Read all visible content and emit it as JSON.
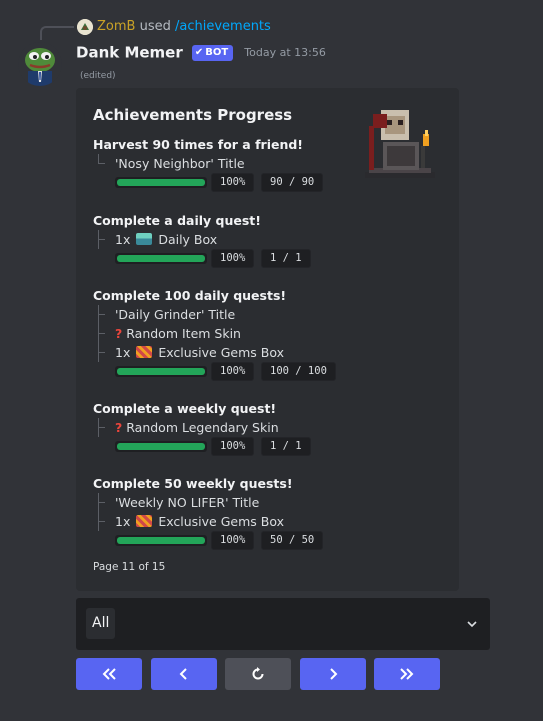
{
  "reply": {
    "username": "ZomB",
    "used_text": "used",
    "command": "/achievements"
  },
  "author": {
    "name": "Dank Memer",
    "bot_tag": "BOT",
    "timestamp": "Today at 13:56",
    "edited": "(edited)"
  },
  "embed": {
    "title": "Achievements Progress",
    "footer": "Page 11 of 15",
    "achievements": [
      {
        "name": "Harvest 90 times for a friend!",
        "rewards": [
          "'Nosy Neighbor' Title"
        ],
        "percent": "100%",
        "count": "90 / 90",
        "progress": 1.0
      },
      {
        "name": "Complete a daily quest!",
        "rewards": [
          {
            "prefix": "1x",
            "icon": "daily-box-icon",
            "label": "Daily Box"
          }
        ],
        "percent": "100%",
        "count": "1 / 1",
        "progress": 1.0
      },
      {
        "name": "Complete 100 daily quests!",
        "rewards": [
          "'Daily Grinder' Title",
          {
            "icon": "question-mark-icon",
            "label": "Random Item Skin"
          },
          {
            "prefix": "1x",
            "icon": "gems-box-icon",
            "label": "Exclusive Gems Box"
          }
        ],
        "percent": "100%",
        "count": "100 / 100",
        "progress": 1.0
      },
      {
        "name": "Complete a weekly quest!",
        "rewards": [
          {
            "icon": "question-mark-icon",
            "label": "Random Legendary Skin"
          }
        ],
        "percent": "100%",
        "count": "1 / 1",
        "progress": 1.0
      },
      {
        "name": "Complete 50 weekly quests!",
        "rewards": [
          "'Weekly NO LIFER' Title",
          {
            "prefix": "1x",
            "icon": "gems-box-icon",
            "label": "Exclusive Gems Box"
          }
        ],
        "percent": "100%",
        "count": "50 / 50",
        "progress": 1.0
      }
    ]
  },
  "select": {
    "value": "All"
  },
  "buttons": [
    {
      "name": "first-page-button",
      "icon": "double-chevron-left-icon"
    },
    {
      "name": "previous-page-button",
      "icon": "chevron-left-icon"
    },
    {
      "name": "refresh-button",
      "icon": "refresh-icon"
    },
    {
      "name": "next-page-button",
      "icon": "chevron-right-icon"
    },
    {
      "name": "last-page-button",
      "icon": "double-chevron-right-icon"
    }
  ],
  "colors": {
    "background": "#313338",
    "embed_background": "#2b2d31",
    "blurple": "#5865f2",
    "progress_green": "#23a559",
    "link_blue": "#00a8fc",
    "reply_username": "#c9a227"
  }
}
